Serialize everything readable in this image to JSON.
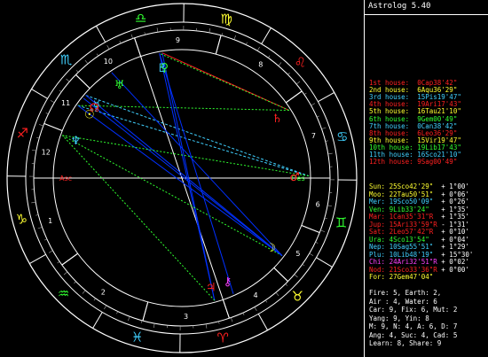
{
  "window": {
    "title": "Astrolog 5.40"
  },
  "houses": [
    {
      "label": "1st house:",
      "value": "0Cap38'42\"",
      "color": "#ff2020"
    },
    {
      "label": "2nd house:",
      "value": "6Aqu36'29\"",
      "color": "#ffff30"
    },
    {
      "label": "3rd house:",
      "value": "15Pis19'47\"",
      "color": "#40d0ff"
    },
    {
      "label": "4th house:",
      "value": "19Ari17'43\"",
      "color": "#ff2020"
    },
    {
      "label": "5th house:",
      "value": "16Tau21'10\"",
      "color": "#ffff30"
    },
    {
      "label": "6th house:",
      "value": "9Gem00'49\"",
      "color": "#30ff30"
    },
    {
      "label": "7th house:",
      "value": "0Can38'42\"",
      "color": "#40d0ff"
    },
    {
      "label": "8th house:",
      "value": "6Leo36'29\"",
      "color": "#ff2020"
    },
    {
      "label": "9th house:",
      "value": "15Vir19'47\"",
      "color": "#ffff30"
    },
    {
      "label": "10th house:",
      "value": "19Lib17'43\"",
      "color": "#30ff30"
    },
    {
      "label": "11th house:",
      "value": "16Sco21'10\"",
      "color": "#40d0ff"
    },
    {
      "label": "12th house:",
      "value": "9Sag00'49\"",
      "color": "#ff2020"
    }
  ],
  "planets": [
    {
      "name": "Sun:",
      "pos": "25Sco42'29\"",
      "speed": "+ 1°00'",
      "color": "#ffff30"
    },
    {
      "name": "Moo:",
      "pos": "22Tau50'51\"",
      "speed": "+ 0°06'",
      "color": "#ffff30"
    },
    {
      "name": "Mer:",
      "pos": "19Sco50'09\"",
      "speed": "+ 0°26'",
      "color": "#40d0ff"
    },
    {
      "name": "Ven:",
      "pos": "9Lib33'24\"",
      "speed": "+ 1°35'",
      "color": "#30ff30"
    },
    {
      "name": "Mar:",
      "pos": "1Can35'31\"R",
      "speed": "+ 1°35'",
      "color": "#ff2020"
    },
    {
      "name": "Jup:",
      "pos": "15Ari33'59\"R",
      "speed": "- 1°31'",
      "color": "#ff2020"
    },
    {
      "name": "Sat:",
      "pos": "2Leo57'42\"R",
      "speed": "+ 0°10'",
      "color": "#ff2020"
    },
    {
      "name": "Ura:",
      "pos": "4Sco13'54\"",
      "speed": "+ 0°04'",
      "color": "#30ff30"
    },
    {
      "name": "Nep:",
      "pos": "10Sag55'51\"",
      "speed": "+ 1°29'",
      "color": "#40d0ff"
    },
    {
      "name": "Plu:",
      "pos": "10Lib48'19\"",
      "speed": "+ 15°30'",
      "color": "#40d0ff"
    },
    {
      "name": "Chi:",
      "pos": "24Ari32'51\"R",
      "speed": "+ 0°02'",
      "color": "#ff40ff"
    },
    {
      "name": "Nod:",
      "pos": "21Sco33'36\"R",
      "speed": "+ 0°00'",
      "color": "#ff2020"
    },
    {
      "name": "For:",
      "pos": "27Gem47'04\"",
      "speed": "",
      "color": "#ffff30"
    }
  ],
  "stats": [
    "Fire: 5, Earth: 2,",
    "Air : 4, Water: 6",
    "Car: 9, Fix: 6, Mut: 2",
    "Yang: 9, Yin: 8",
    "M: 9, N: 4, A: 6, D: 7",
    "Ang: 4, Suc: 4, Cad: 5",
    "Learn: 8, Share: 9"
  ],
  "zodiac": [
    {
      "glyph": "♈",
      "color": "#ff2020"
    },
    {
      "glyph": "♉",
      "color": "#ffff30"
    },
    {
      "glyph": "♊",
      "color": "#30ff30"
    },
    {
      "glyph": "♋",
      "color": "#40d0ff"
    },
    {
      "glyph": "♌",
      "color": "#ff2020"
    },
    {
      "glyph": "♍",
      "color": "#ffff30"
    },
    {
      "glyph": "♎",
      "color": "#30ff30"
    },
    {
      "glyph": "♏",
      "color": "#40d0ff"
    },
    {
      "glyph": "♐",
      "color": "#ff2020"
    },
    {
      "glyph": "♑",
      "color": "#ffff30"
    },
    {
      "glyph": "♒",
      "color": "#30ff30"
    },
    {
      "glyph": "♓",
      "color": "#40d0ff"
    }
  ],
  "house_numbers": [
    "1",
    "2",
    "3",
    "4",
    "5",
    "6",
    "7",
    "8",
    "9",
    "10",
    "11",
    "12"
  ],
  "asc_label": "Asc",
  "desc_label": "Des",
  "mc_label": "MC",
  "ic_label": "IC"
}
